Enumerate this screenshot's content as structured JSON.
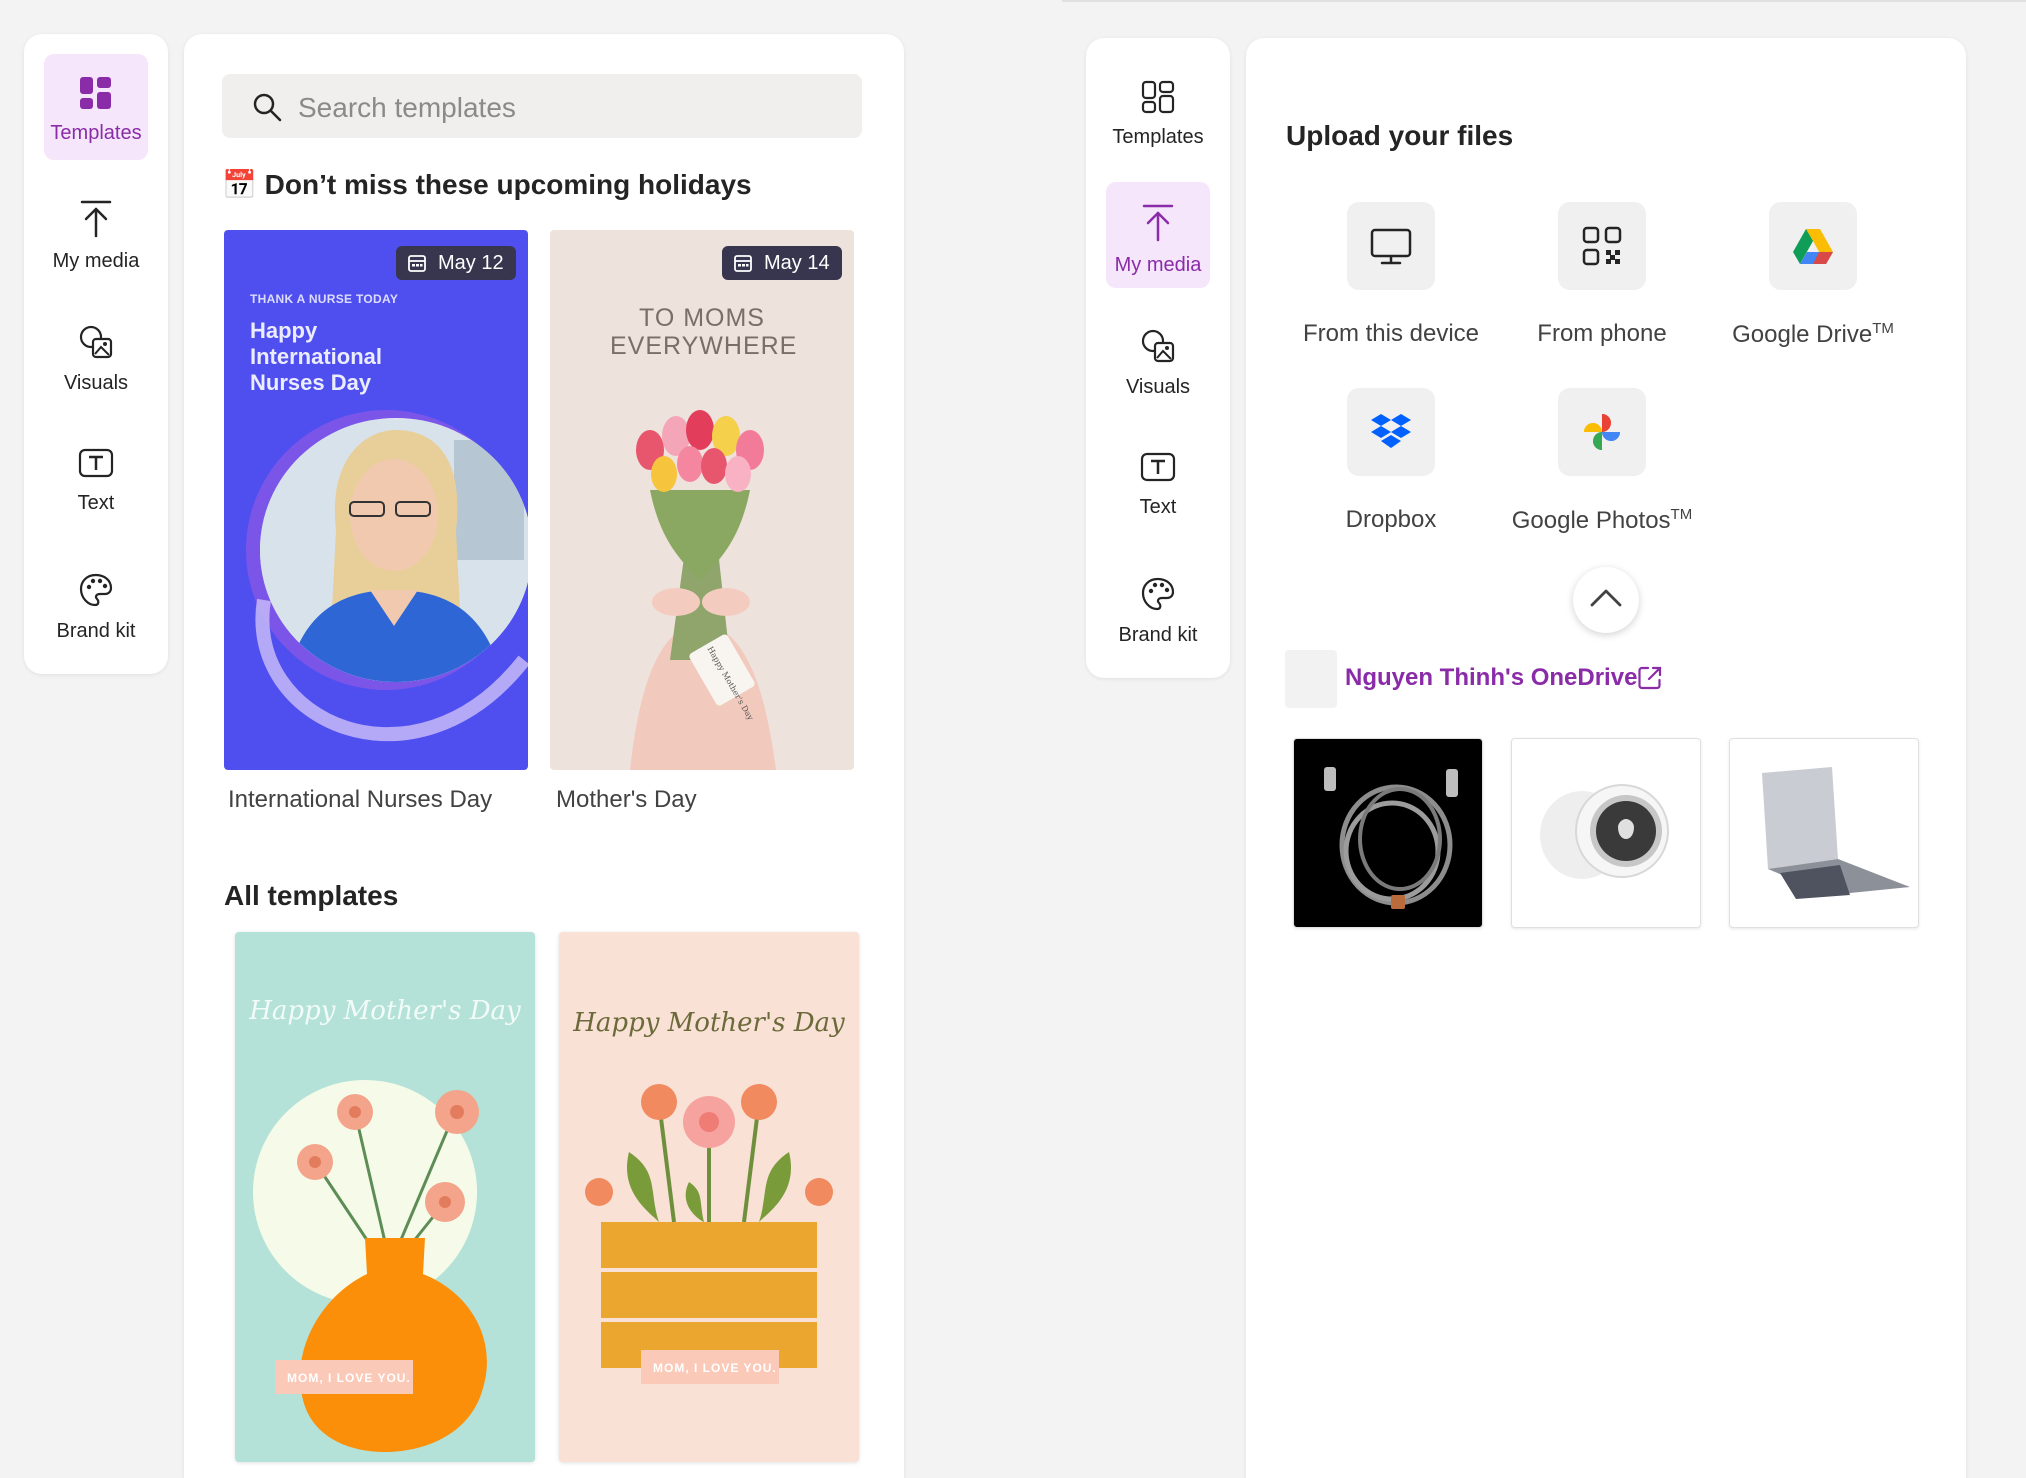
{
  "left_rail": {
    "items": [
      {
        "label": "Templates",
        "icon": "templates-icon",
        "active": true
      },
      {
        "label": "My media",
        "icon": "upload-icon",
        "active": false
      },
      {
        "label": "Visuals",
        "icon": "visuals-icon",
        "active": false
      },
      {
        "label": "Text",
        "icon": "text-icon",
        "active": false
      },
      {
        "label": "Brand kit",
        "icon": "palette-icon",
        "active": false
      }
    ]
  },
  "templates_panel": {
    "search_placeholder": "Search templates",
    "holidays_emoji": "📅",
    "holidays_title": "Don’t miss these upcoming holidays",
    "holiday_cards": [
      {
        "date": "May 12",
        "caption": "International Nurses Day",
        "kicker": "THANK A NURSE TODAY",
        "headline": "Happy International Nurses Day"
      },
      {
        "date": "May 14",
        "caption": "Mother's Day",
        "headline": "TO MOMS EVERYWHERE",
        "tag": "Happy Mother's Day"
      }
    ],
    "all_title": "All templates",
    "all_cards": [
      {
        "script": "Happy Mother's Day",
        "tag": "MOM, I LOVE YOU."
      },
      {
        "script": "Happy Mother's Day",
        "tag": "MOM, I LOVE YOU."
      }
    ]
  },
  "right_rail": {
    "items": [
      {
        "label": "Templates",
        "icon": "templates-icon",
        "active": false
      },
      {
        "label": "My media",
        "icon": "upload-icon",
        "active": true
      },
      {
        "label": "Visuals",
        "icon": "visuals-icon",
        "active": false
      },
      {
        "label": "Text",
        "icon": "text-icon",
        "active": false
      },
      {
        "label": "Brand kit",
        "icon": "palette-icon",
        "active": false
      }
    ]
  },
  "upload_panel": {
    "title": "Upload your files",
    "sources": [
      {
        "label": "From this device",
        "icon": "monitor-icon"
      },
      {
        "label": "From phone",
        "icon": "qr-code-icon"
      },
      {
        "label": "Google Drive",
        "tm": "TM",
        "icon": "google-drive-icon"
      },
      {
        "label": "Dropbox",
        "icon": "dropbox-icon"
      },
      {
        "label": "Google Photos",
        "tm": "TM",
        "icon": "google-photos-icon"
      }
    ],
    "onedrive_label": "Nguyen Thinh's OneDrive",
    "thumbnails": [
      "usb-cable",
      "airtag",
      "laptop-stand"
    ]
  },
  "colors": {
    "accent": "#8a2ba8",
    "accent_bg": "#f5e6fb",
    "nurse_bg": "#4f4ff0"
  }
}
